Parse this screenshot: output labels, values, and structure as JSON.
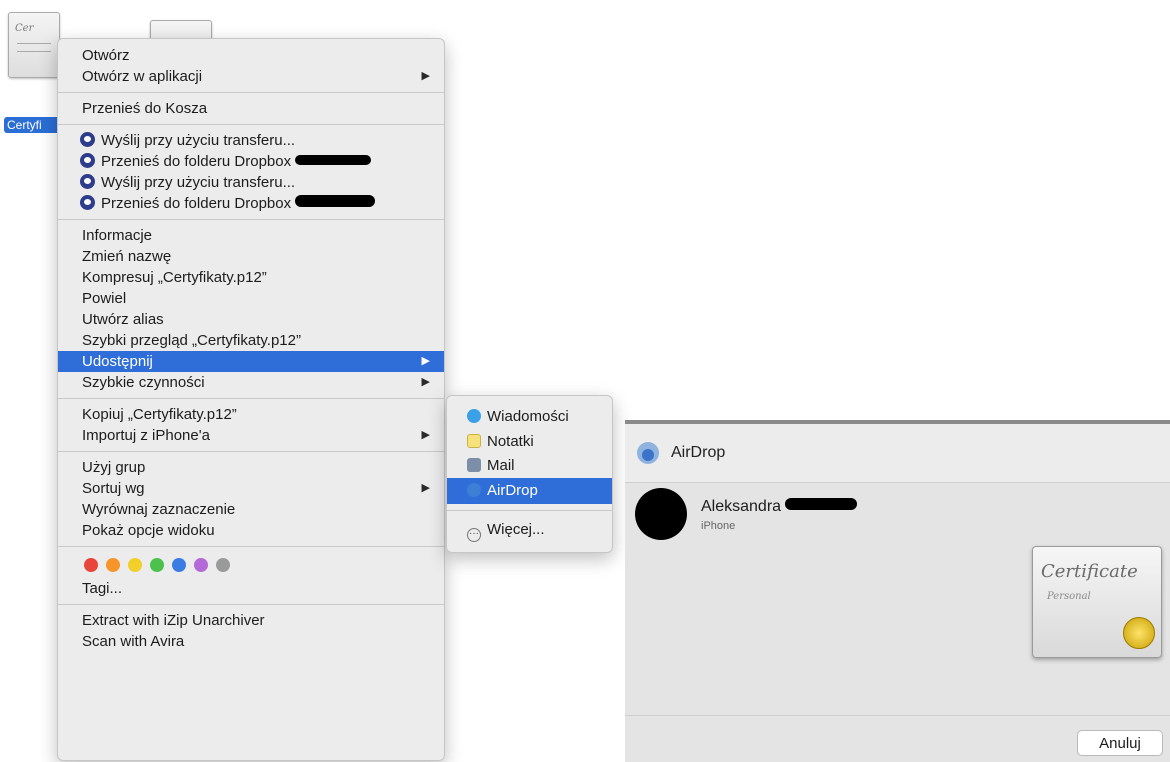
{
  "desktop": {
    "file_label": "Certyfi",
    "file_icon_text": "Cer"
  },
  "menu": {
    "open": "Otwórz",
    "open_with": "Otwórz w aplikacji",
    "move_to_trash": "Przenieś do Kosza",
    "dropbox_send_1": "Wyślij przy użyciu transferu...",
    "dropbox_move_1": "Przenieś do folderu Dropbox",
    "dropbox_send_2": "Wyślij przy użyciu transferu...",
    "dropbox_move_2": "Przenieś do folderu Dropbox",
    "get_info": "Informacje",
    "rename": "Zmień nazwę",
    "compress": "Kompresuj „Certyfikaty.p12”",
    "duplicate": "Powiel",
    "make_alias": "Utwórz alias",
    "quick_look": "Szybki przegląd „Certyfikaty.p12”",
    "share": "Udostępnij",
    "quick_actions": "Szybkie czynności",
    "copy": "Kopiuj „Certyfikaty.p12”",
    "import_iphone": "Importuj z iPhone'a",
    "use_groups": "Użyj grup",
    "sort_by": "Sortuj wg",
    "clean_up": "Wyrównaj zaznaczenie",
    "view_options": "Pokaż opcje widoku",
    "tags_label": "Tagi...",
    "izip": "Extract with iZip Unarchiver",
    "avira": "Scan with Avira",
    "tag_colors": [
      "#e8463c",
      "#f5952a",
      "#f3cf2a",
      "#4cc14d",
      "#3a7ce3",
      "#b36ad6",
      "#9a9a9a"
    ]
  },
  "share_menu": {
    "messages": "Wiadomości",
    "notes": "Notatki",
    "mail": "Mail",
    "airdrop": "AirDrop",
    "more": "Więcej..."
  },
  "airdrop_panel": {
    "title": "AirDrop",
    "person_name": "Aleksandra",
    "device": "iPhone",
    "file_preview_title": "Certificate",
    "file_preview_subtitle": "Personal",
    "cancel": "Anuluj"
  },
  "colors": {
    "highlight": "#2f6ed8",
    "dropbox": "#2d3c8c"
  }
}
